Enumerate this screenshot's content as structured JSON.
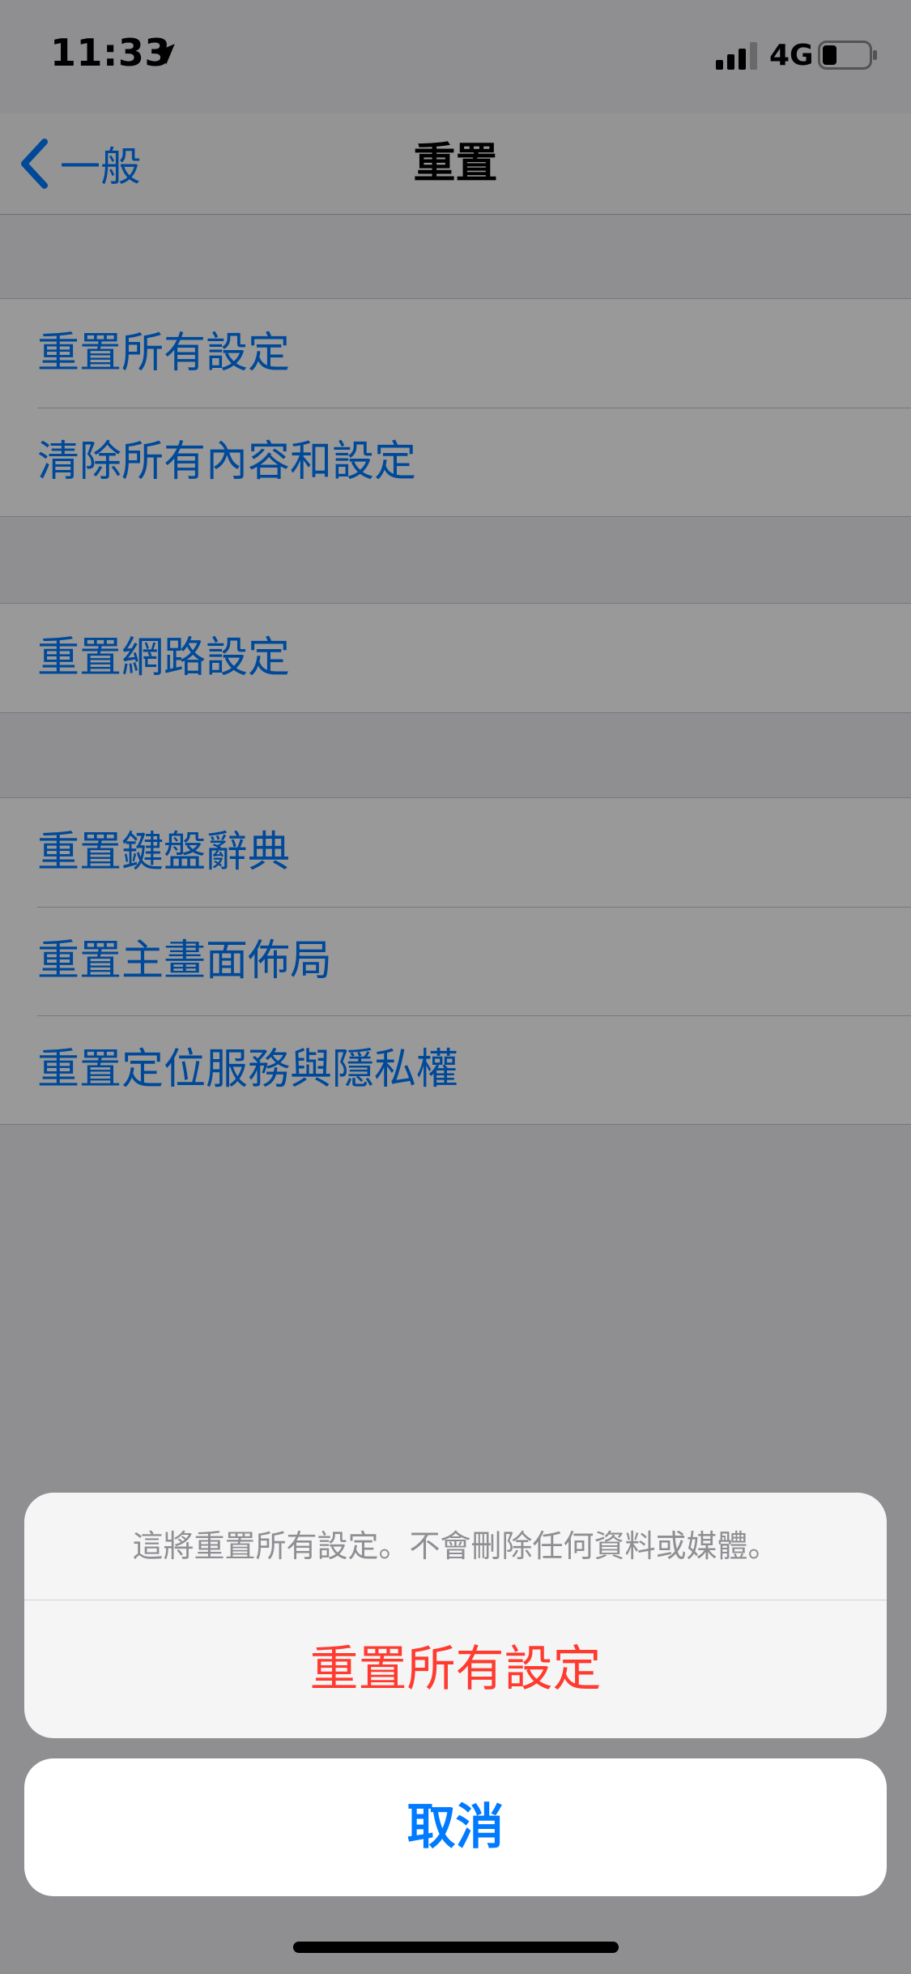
{
  "status_bar": {
    "time": "11:33",
    "network": "4G",
    "icons": [
      "location-arrow-icon",
      "signal-bars-icon",
      "battery-icon"
    ]
  },
  "nav": {
    "back_label": "一般",
    "title": "重置"
  },
  "groups": [
    {
      "items": [
        {
          "label": "重置所有設定"
        },
        {
          "label": "清除所有內容和設定"
        }
      ]
    },
    {
      "items": [
        {
          "label": "重置網路設定"
        }
      ]
    },
    {
      "items": [
        {
          "label": "重置鍵盤辭典"
        },
        {
          "label": "重置主畫面佈局"
        },
        {
          "label": "重置定位服務與隱私權"
        }
      ]
    }
  ],
  "action_sheet": {
    "message": "這將重置所有設定。不會刪除任何資料或媒體。",
    "destructive_label": "重置所有設定",
    "cancel_label": "取消"
  },
  "colors": {
    "accent": "#007aff",
    "destructive": "#ff3b30",
    "list_background": "#efeff4"
  }
}
